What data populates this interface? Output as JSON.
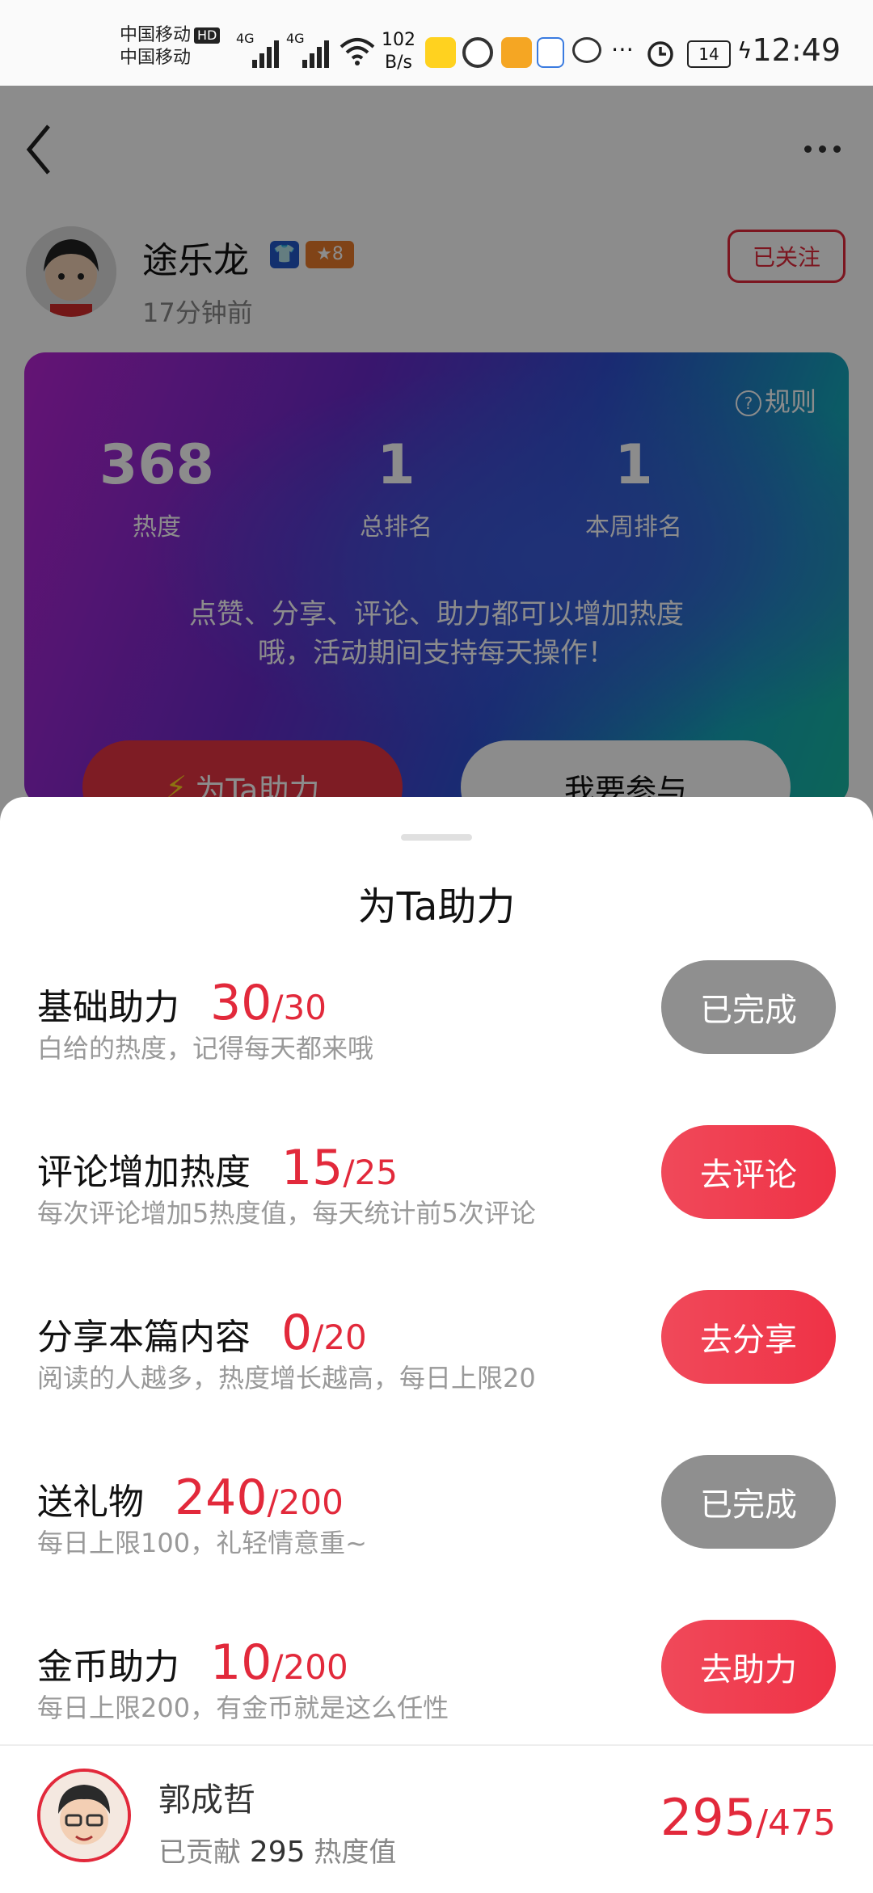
{
  "status_bar": {
    "carrier1": "中国移动",
    "carrier2": "中国移动",
    "hd": "HD",
    "net1": "4G",
    "net2": "4G",
    "speed_value": "102",
    "speed_unit": "B/s",
    "battery": "14",
    "time": "12:49"
  },
  "header": {
    "back_icon": "chevron-left-icon",
    "more_icon": "more-dots-icon"
  },
  "author": {
    "name": "途乐龙",
    "badge_level": "8",
    "time": "17分钟前",
    "follow_label": "已关注"
  },
  "card": {
    "rules_label": "规则",
    "stats": [
      {
        "value": "368",
        "label": "热度"
      },
      {
        "value": "1",
        "label": "总排名"
      },
      {
        "value": "1",
        "label": "本周排名"
      }
    ],
    "desc_line1": "点赞、分享、评论、助力都可以增加热度",
    "desc_line2": "哦，活动期间支持每天操作！",
    "help_label": "为Ta助力",
    "join_label": "我要参与"
  },
  "sheet": {
    "title": "为Ta助力",
    "tasks": [
      {
        "name": "基础助力",
        "current": "30",
        "total": "/30",
        "desc": "白给的热度，记得每天都来哦",
        "button": "已完成",
        "done": true
      },
      {
        "name": "评论增加热度",
        "current": "15",
        "total": "/25",
        "desc": "每次评论增加5热度值，每天统计前5次评论",
        "button": "去评论",
        "done": false
      },
      {
        "name": "分享本篇内容",
        "current": "0",
        "total": "/20",
        "desc": "阅读的人越多，热度增长越高，每日上限20",
        "button": "去分享",
        "done": false
      },
      {
        "name": "送礼物",
        "current": "240",
        "total": "/200",
        "desc": "每日上限100，礼轻情意重~",
        "button": "已完成",
        "done": true
      },
      {
        "name": "金币助力",
        "current": "10",
        "total": "/200",
        "desc": "每日上限200，有金币就是这么任性",
        "button": "去助力",
        "done": false
      }
    ],
    "footer": {
      "name": "郭成哲",
      "contrib_prefix": "已贡献",
      "contrib_value": "295",
      "contrib_suffix": "热度值",
      "total_current": "295",
      "total_max": "/475"
    }
  }
}
